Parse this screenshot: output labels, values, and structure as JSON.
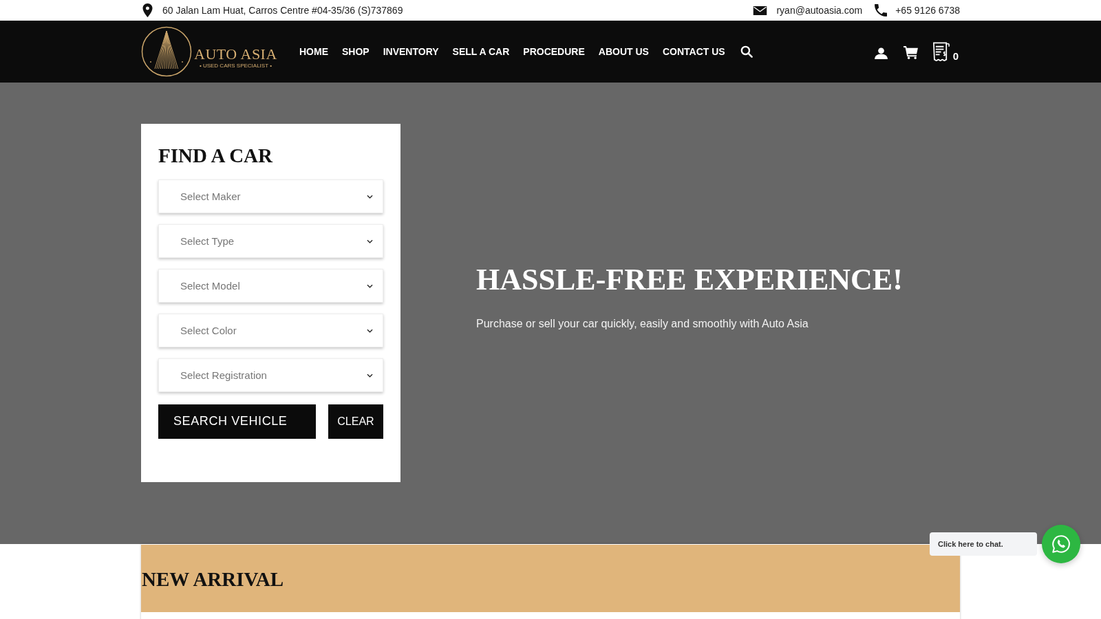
{
  "top_bar": {
    "address": "60 Jalan Lam Huat, Carros Centre #04-35/36 (S)737869",
    "email": "ryan@autoasia.com",
    "phone": "+65 9126 6738"
  },
  "header": {
    "logo": {
      "name": "AUTO ASIA",
      "tagline": "• USED CARS SPECIALIST •"
    },
    "nav": [
      {
        "label": "HOME"
      },
      {
        "label": "SHOP"
      },
      {
        "label": "INVENTORY"
      },
      {
        "label": "SELL A CAR"
      },
      {
        "label": "PROCEDURE"
      },
      {
        "label": "ABOUT US"
      },
      {
        "label": "CONTACT US"
      }
    ],
    "quote_count": "0"
  },
  "hero": {
    "finder": {
      "title": "FIND A CAR",
      "selects": [
        {
          "placeholder": "Select Maker"
        },
        {
          "placeholder": "Select Type"
        },
        {
          "placeholder": "Select Model"
        },
        {
          "placeholder": "Select Color"
        },
        {
          "placeholder": "Select Registration"
        }
      ],
      "buttons": [
        {
          "label": "SEARCH VEHICLE",
          "kind": "primary"
        },
        {
          "label": "CLEAR",
          "kind": "secondary"
        }
      ]
    },
    "headline": "HASSLE-FREE EXPERIENCE!",
    "subtitle": "Purchase or sell your car quickly, easily and smoothly with Auto Asia"
  },
  "new_arrival": {
    "title": "NEW ARRIVAL"
  },
  "chat": {
    "prompt": "Click here to chat."
  }
}
